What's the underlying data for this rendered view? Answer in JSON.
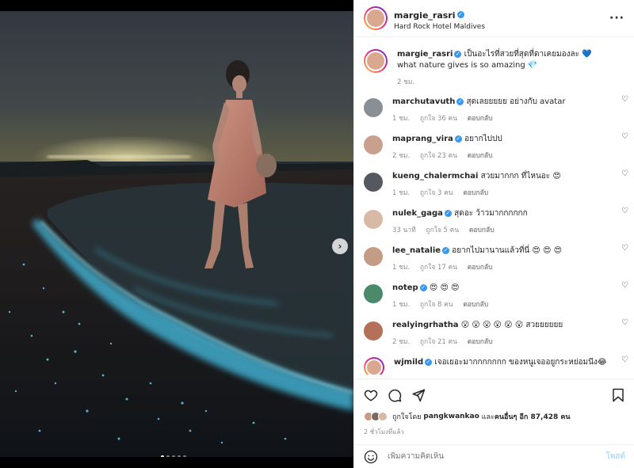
{
  "post": {
    "username": "margie_rasri",
    "location": "Hard Rock Hotel Maldives",
    "caption_text": "เป็นอะไรที่สวยที่สุดที่ดาเคยมองละ 💙 what nature gives is so amazing 💎",
    "caption_time": "2 ชม.",
    "carousel_count": 5,
    "carousel_active": 0
  },
  "comments": [
    {
      "username": "marchutavuth",
      "text": "สุดเลยยยยย อย่างกับ avatar",
      "time": "1 ชม.",
      "likes": "ถูกใจ 36 คน",
      "reply": "ตอบกลับ",
      "avatar_color": "#8a8f96"
    },
    {
      "username": "maprang_vira",
      "text": "อยากไปปป",
      "time": "2 ชม.",
      "likes": "ถูกใจ 23 คน",
      "reply": "ตอบกลับ",
      "avatar_color": "#c9a08e"
    },
    {
      "username": "kueng_chalermchai",
      "text": "สวยมากกก ที่ไหนอะ 😍",
      "time": "1 ชม.",
      "likes": "ถูกใจ 3 คน",
      "reply": "ตอบกลับ",
      "avatar_color": "#55585e"
    },
    {
      "username": "nulek_gaga",
      "text": "สุดอะ ว้าวมากกกกกก",
      "time": "33 นาที",
      "likes": "ถูกใจ 5 คน",
      "reply": "ตอบกลับ",
      "avatar_color": "#d8b9a6"
    },
    {
      "username": "lee_natalie",
      "text": "อยากไปมานานแล้วที่นี่ 😍 😍 😍",
      "time": "1 ชม.",
      "likes": "ถูกใจ 17 คน",
      "reply": "ตอบกลับ",
      "avatar_color": "#c49c86"
    },
    {
      "username": "notep",
      "text": "😍 😍 😍",
      "time": "1 ชม.",
      "likes": "ถูกใจ 8 คน",
      "reply": "ตอบกลับ",
      "avatar_color": "#4a8a6a"
    },
    {
      "username": "realyingrhatha",
      "text": "😮 😮 😮 😮 😮 😮 สวยยยยยย",
      "time": "2 ชม.",
      "likes": "ถูกใจ 21 คน",
      "reply": "ตอบกลับ",
      "avatar_color": "#b5705a"
    },
    {
      "username": "wjmild",
      "text": "เจอเยอะมากกกกกกก ของหนูเจออยูกระหย่อมนึง😂",
      "time": "",
      "likes": "",
      "reply": "",
      "avatar_color": "#d9a88f"
    }
  ],
  "engagement": {
    "liked_by_prefix": "ถูกใจโดย",
    "liked_by_user": "pangkwankao",
    "liked_by_middle": "และ",
    "liked_by_others": "คนอื่นๆ อีก 87,428 คน",
    "time_ago": "2 ชั่วโมงที่แล้ว"
  },
  "add_comment": {
    "placeholder": "เพิ่มความคิดเห็น",
    "post_label": "โพสต์"
  },
  "icons": {
    "more": "more-icon",
    "next": "chevron-right-icon",
    "heart": "heart-icon",
    "comment": "comment-icon",
    "share": "share-icon",
    "save": "bookmark-icon",
    "emoji": "emoji-icon"
  },
  "colors": {
    "verified": "#3897f0",
    "post_button_disabled": "#b2dffc",
    "bioluminescence": "#4fd8ff"
  }
}
